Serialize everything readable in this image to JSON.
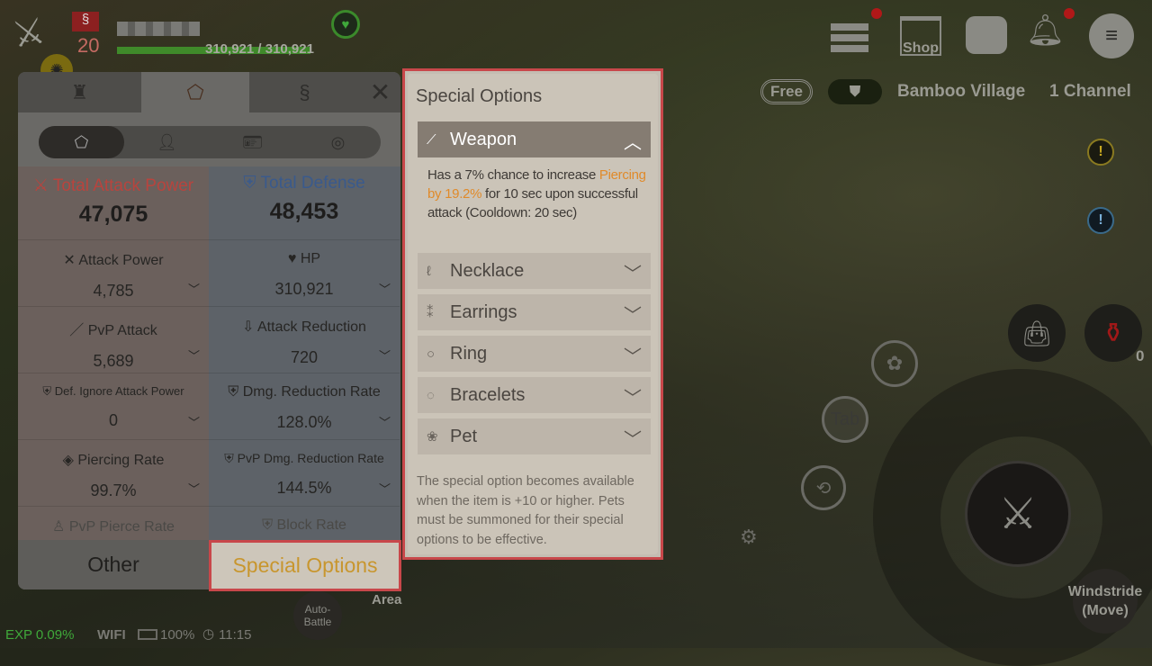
{
  "hud": {
    "level": "20",
    "hp_text": "310,921 / 310,921",
    "hp_fraction": 1.0,
    "exp": "EXP 0.09%",
    "wifi": "WIFI",
    "battery": "100%",
    "clock": "11:15",
    "shop_label": "Shop",
    "free_label": "Free",
    "location": "Bamboo Village",
    "channel": "1 Channel",
    "tab_button": "Tab",
    "auto_battle": "Auto-Battle",
    "area": "Area",
    "windstride": "Windstride (Move)",
    "potion_count": "0"
  },
  "panel": {
    "tabs": [
      {
        "icon": "armor-icon"
      },
      {
        "icon": "pentagon-icon",
        "active": true
      },
      {
        "icon": "dragon-icon"
      }
    ],
    "close_icon": "✕",
    "subtabs": [
      {
        "icon": "pentagon-icon",
        "active": true
      },
      {
        "icon": "person-icon"
      },
      {
        "icon": "person-card-icon"
      },
      {
        "icon": "coin-icon"
      }
    ],
    "total_attack": {
      "label": "Total Attack Power",
      "value": "47,075"
    },
    "total_defense": {
      "label": "Total Defense",
      "value": "48,453"
    },
    "stats": [
      {
        "icon": "✕",
        "label": "Attack Power",
        "value": "4,785"
      },
      {
        "icon": "♥",
        "label": "HP",
        "value": "310,921"
      },
      {
        "icon": "／",
        "label": "PvP Attack",
        "value": "5,689"
      },
      {
        "icon": "⇩",
        "label": "Attack Reduction",
        "value": "720"
      },
      {
        "icon": "⛨",
        "label": "Def. Ignore Attack Power",
        "value": "0"
      },
      {
        "icon": "⛨",
        "label": "Dmg. Reduction Rate",
        "value": "128.0%"
      },
      {
        "icon": "◈",
        "label": "Piercing Rate",
        "value": "99.7%"
      },
      {
        "icon": "⛨",
        "label": "PvP Dmg. Reduction Rate",
        "value": "144.5%"
      },
      {
        "icon": "♙",
        "label": "PvP Pierce Rate"
      },
      {
        "icon": "⛨",
        "label": "Block Rate"
      }
    ],
    "other_label": "Other",
    "special_label": "Special Options"
  },
  "special": {
    "title": "Special Options",
    "items": [
      {
        "label": "Weapon",
        "icon": "sword-icon",
        "glyph": "⟋",
        "open": true
      },
      {
        "label": "Necklace",
        "icon": "necklace-icon",
        "glyph": "ℓ"
      },
      {
        "label": "Earrings",
        "icon": "earrings-icon",
        "glyph": "⁑"
      },
      {
        "label": "Ring",
        "icon": "ring-icon",
        "glyph": "○"
      },
      {
        "label": "Bracelets",
        "icon": "bracelet-icon",
        "glyph": "◌"
      },
      {
        "label": "Pet",
        "icon": "paw-icon",
        "glyph": "❀"
      }
    ],
    "weapon_desc": {
      "pre": "Has a 7% chance to increase ",
      "highlight": "Piercing by 19.2%",
      "post": " for 10 sec upon successful attack (Cooldown: 20 sec)"
    },
    "footer": "The special option becomes available when the item is +10 or higher. Pets must be summoned for their special options to be effective."
  },
  "colors": {
    "highlight_border": "#c8474a",
    "accent_orange": "#e08a2a",
    "special_gold": "#c8962e",
    "attack_red": "#b8443e",
    "defense_blue": "#3a5a8c",
    "exp_green": "#3fa83a"
  }
}
